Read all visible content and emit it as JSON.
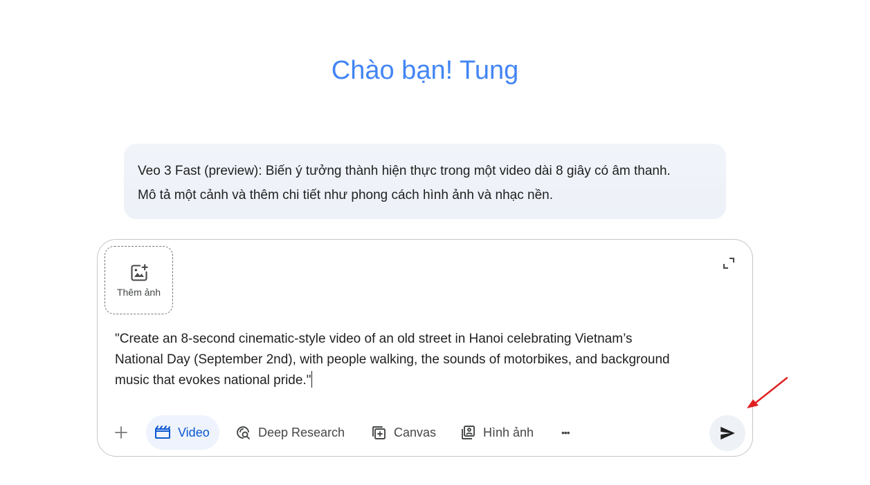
{
  "greeting": "Chào bạn! Tung",
  "info": {
    "line1": "Veo 3 Fast (preview): Biến ý tưởng thành hiện thực trong một video dài 8 giây có âm thanh.",
    "line2": "Mô tả một cảnh và thêm chi tiết như phong cách hình ảnh và nhạc nền."
  },
  "composer": {
    "add_image_label": "Thêm ảnh",
    "prompt_lines": [
      "\"Create an 8-second cinematic-style video of an old street in Hanoi celebrating Vietnam’s",
      "National Day (September 2nd), with people walking, the sounds of motorbikes, and background",
      "music that evokes national pride.\""
    ],
    "tools": {
      "video": "Video",
      "deep_research": "Deep Research",
      "canvas": "Canvas",
      "images": "Hình ảnh"
    },
    "more_label": "•••"
  },
  "colors": {
    "greeting": "#4285f4",
    "accent": "#0b57d0",
    "annotation_arrow": "#e02020"
  }
}
